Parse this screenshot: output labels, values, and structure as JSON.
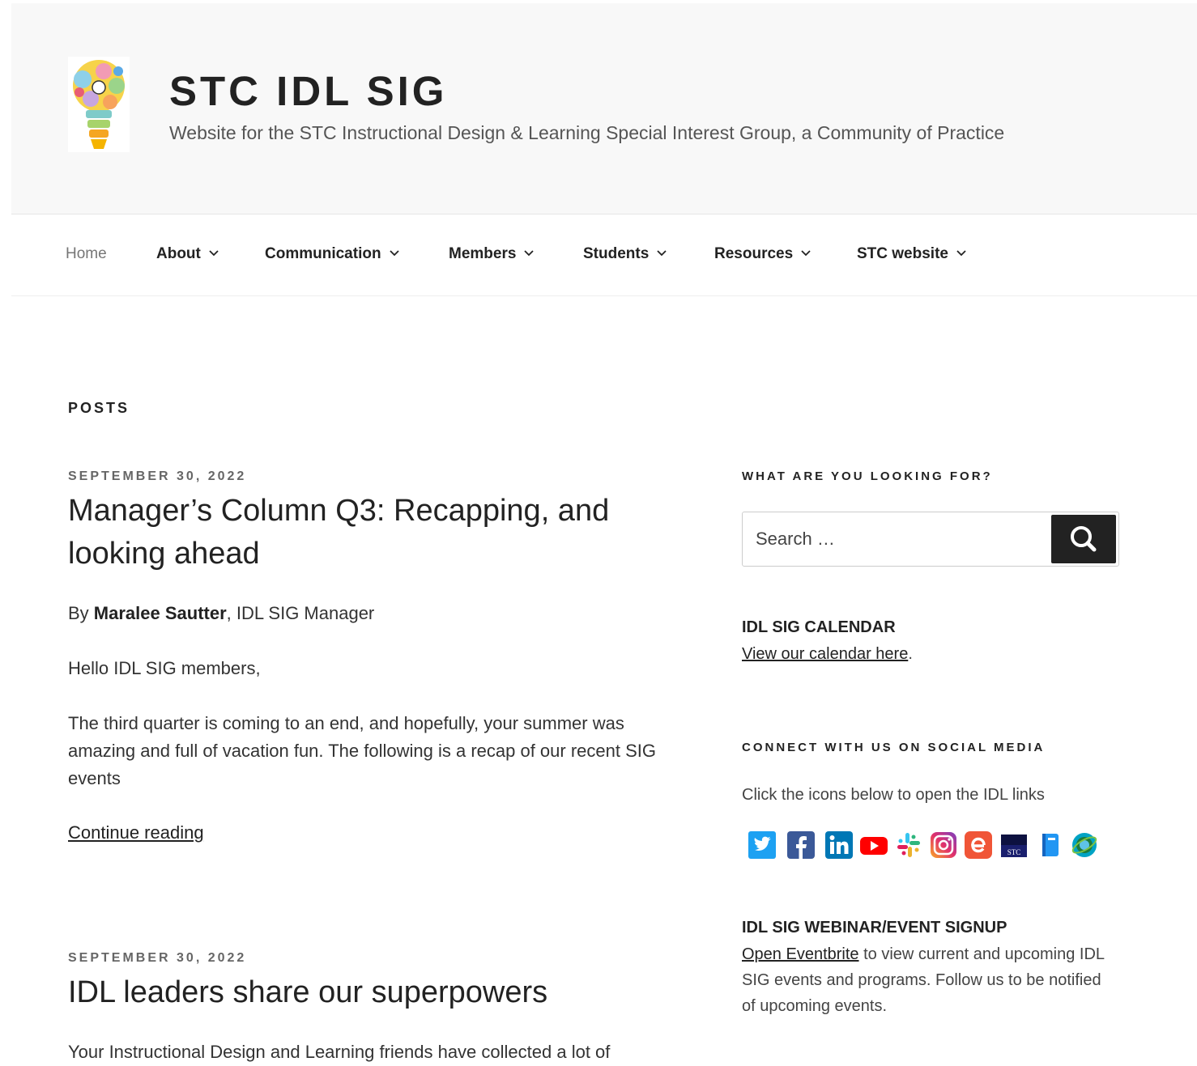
{
  "header": {
    "title": "STC IDL SIG",
    "description": "Website for the STC Instructional Design & Learning Special Interest Group, a Community of Practice"
  },
  "nav": {
    "items": [
      {
        "label": "Home"
      },
      {
        "label": "About"
      },
      {
        "label": "Communication"
      },
      {
        "label": "Members"
      },
      {
        "label": "Students"
      },
      {
        "label": "Resources"
      },
      {
        "label": "STC website"
      }
    ]
  },
  "main": {
    "section_label": "POSTS",
    "posts": [
      {
        "date": "SEPTEMBER 30, 2022",
        "title_line1": "Manager’s Column Q3: Recapping, and",
        "title_line2": "looking ahead",
        "byline_prefix": "By ",
        "byline_author": "Maralee Sautter",
        "byline_suffix": ", IDL SIG Manager",
        "greeting": "Hello IDL SIG members,",
        "excerpt": "The third quarter is coming to an end, and hopefully, your summer was amazing and full of vacation fun. The following is a recap of our recent SIG events",
        "continue_label": "Continue reading"
      },
      {
        "date": "SEPTEMBER 30, 2022",
        "title": "IDL leaders share our superpowers",
        "excerpt": "Your Instructional Design and Learning friends have collected a lot of"
      }
    ]
  },
  "sidebar": {
    "search": {
      "heading": "WHAT ARE YOU LOOKING FOR?",
      "placeholder": "Search …",
      "button_icon": "search-icon"
    },
    "calendar": {
      "heading": "IDL SIG CALENDAR",
      "link_label": "View our calendar here",
      "after_link": "."
    },
    "social": {
      "heading": "CONNECT WITH US ON SOCIAL MEDIA",
      "intro": "Click the icons below to open the IDL links",
      "icons": [
        "twitter-icon",
        "facebook-icon",
        "linkedin-icon",
        "youtube-icon",
        "slack-icon",
        "instagram-icon",
        "eventbrite-icon",
        "stc-icon",
        "notebook-icon",
        "globe-icon"
      ],
      "stc_text": "STC"
    },
    "signup": {
      "heading": "IDL SIG WEBINAR/EVENT SIGNUP",
      "link_label": "Open Eventbrite",
      "text": " to view current and upcoming IDL SIG events and programs. Follow us to be notified of upcoming events."
    }
  },
  "colors": {
    "header_bg": "#f8f8f8",
    "text": "#222222",
    "muted": "#767676",
    "search_button": "#222222",
    "twitter": "#1da1f2",
    "facebook": "#3b5998",
    "linkedin": "#0077b5",
    "youtube": "#ff0000",
    "eventbrite": "#f05537"
  }
}
